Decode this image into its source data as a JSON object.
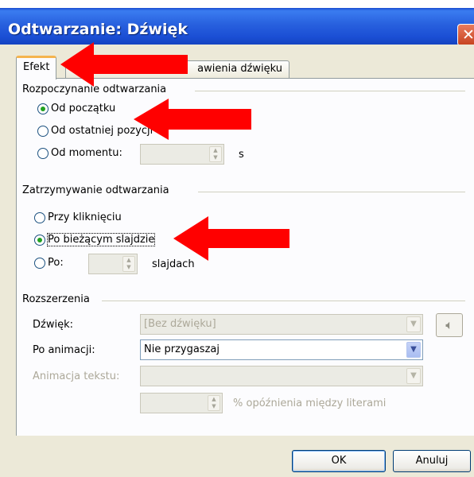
{
  "window": {
    "title": "Odtwarzanie: Dźwięk",
    "close_glyph": "✕"
  },
  "tabs": [
    {
      "label": "Efekt",
      "active": true
    },
    {
      "label": "Ustawienia dźwięku",
      "visible_part": "awienia dźwięku",
      "active": false
    }
  ],
  "start_section": {
    "label": "Rozpoczynanie odtwarzania",
    "options": [
      {
        "label": "Od początku",
        "checked": true
      },
      {
        "label": "Od ostatniej pozycji",
        "checked": false
      },
      {
        "label": "Od momentu:",
        "checked": false
      }
    ],
    "unit": "s"
  },
  "stop_section": {
    "label": "Zatrzymywanie odtwarzania",
    "options": [
      {
        "label": "Przy kliknięciu",
        "checked": false
      },
      {
        "label": "Po bieżącym slajdzie",
        "checked": true
      },
      {
        "label": "Po:",
        "checked": false
      }
    ],
    "unit": "slajdach"
  },
  "enhancements": {
    "label": "Rozszerzenia",
    "sound_label": "Dźwięk:",
    "sound_value": "[Bez dźwięku]",
    "after_anim_label": "Po animacji:",
    "after_anim_value": "Nie przygaszaj",
    "text_anim_label": "Animacja tekstu:",
    "text_anim_value": "",
    "delay_label": "% opóźnienia między literami"
  },
  "buttons": {
    "ok": "OK",
    "cancel": "Anuluj"
  },
  "icons": {
    "speaker": "speaker-icon",
    "dropdown": "chevron-down-icon",
    "spin": "spin-arrows-icon"
  },
  "colors": {
    "titlebar": "#2860de",
    "annotation_arrow": "#ff0000",
    "radio_dot": "#21a121",
    "tab_highlight": "#f5b44e"
  }
}
